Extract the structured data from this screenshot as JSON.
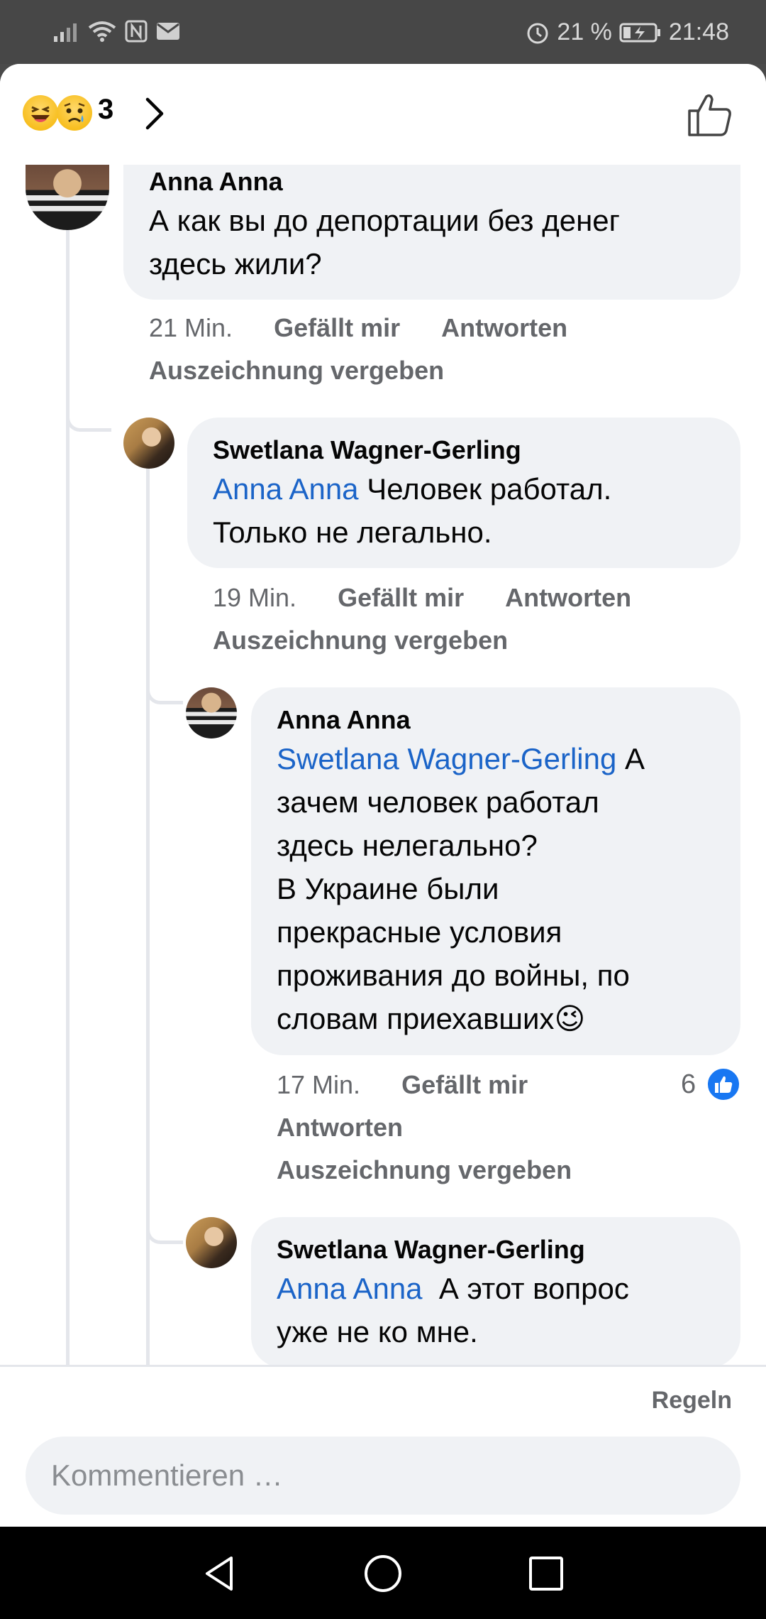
{
  "status_bar": {
    "battery": "21 %",
    "time": "21:48"
  },
  "header": {
    "reaction_count": "3",
    "icons": [
      "haha-emoji-icon",
      "sad-emoji-icon",
      "chevron-right-icon",
      "thumbs-up-icon"
    ]
  },
  "comments": [
    {
      "author": "Anna Anna",
      "mention": "",
      "text_lines": [
        "А как вы до депортации без денег",
        "здесь жили?"
      ],
      "time": "21 Min.",
      "like": "Gefällt mir",
      "reply": "Antworten",
      "award": "Auszeichnung vergeben"
    },
    {
      "author": "Swetlana Wagner-Gerling",
      "mention": "Anna Anna",
      "text_first": " Человек работал.",
      "text_lines": [
        "Только не легально."
      ],
      "time": "19 Min.",
      "like": "Gefällt mir",
      "reply": "Antworten",
      "award": "Auszeichnung vergeben"
    },
    {
      "author": "Anna Anna",
      "mention": "Swetlana Wagner-Gerling",
      "text_first": " А",
      "text_lines": [
        "зачем человек работал",
        "здесь нелегально?",
        "В Украине были",
        "прекрасные условия",
        "проживания до войны, по",
        "словам приехавших"
      ],
      "emoji": "😉",
      "time": "17 Min.",
      "like": "Gefällt mir",
      "reply": "Antworten",
      "award": "Auszeichnung vergeben",
      "like_count": "6"
    },
    {
      "author": "Swetlana Wagner-Gerling",
      "mention": "Anna Anna",
      "text_first": "  А этот вопрос",
      "text_lines": [
        "уже не ко мне."
      ]
    }
  ],
  "footer": {
    "rules": "Regeln",
    "placeholder": "Kommentieren …"
  },
  "colors": {
    "mention": "#1b64c8",
    "bubble": "#f0f2f5",
    "meta": "#65676b",
    "like_badge": "#1877f2"
  }
}
